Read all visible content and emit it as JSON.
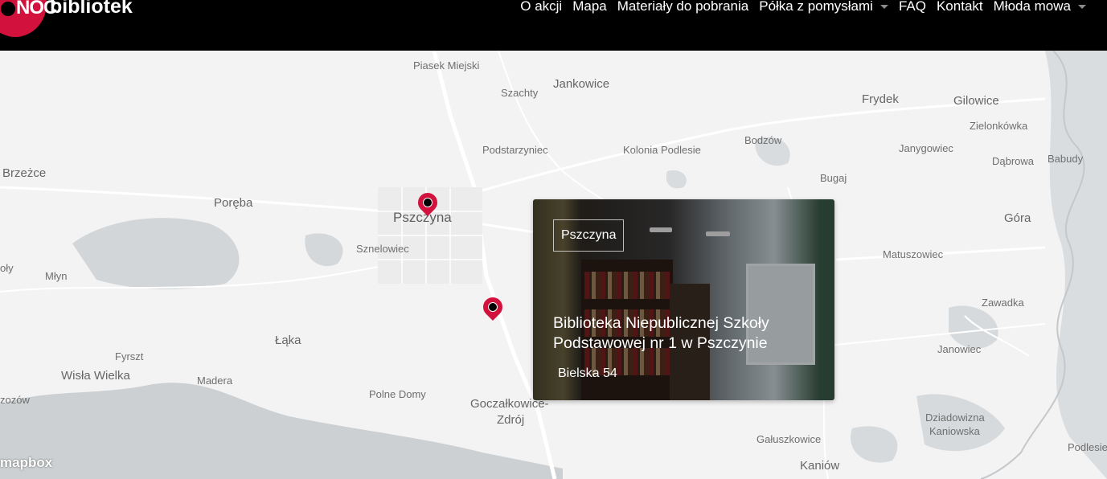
{
  "brand": {
    "logo_mark": "NOC",
    "logo_text": "bibliotek"
  },
  "nav": [
    {
      "label": "O akcji",
      "dropdown": false
    },
    {
      "label": "Mapa",
      "dropdown": false
    },
    {
      "label": "Materiały do pobrania",
      "dropdown": false
    },
    {
      "label": "Półka z pomysłami",
      "dropdown": true
    },
    {
      "label": "FAQ",
      "dropdown": false
    },
    {
      "label": "Kontakt",
      "dropdown": false
    },
    {
      "label": "Młoda mowa",
      "dropdown": true
    }
  ],
  "map": {
    "places": {
      "piasek_miejski": "Piasek Miejski",
      "jankowice": "Jankowice",
      "szachty": "Szachty",
      "frydek": "Frydek",
      "gilowice": "Gilowice",
      "zielonkowka": "Zielonkówka",
      "podstarzyniec": "Podstarzyniec",
      "kolonia_podlesie": "Kolonia Podlesie",
      "bodzow": "Bodzów",
      "janygowiec": "Janygowiec",
      "dabrowa": "Dąbrowa",
      "babudy": "Babudy",
      "brzezce": "Brzeżce",
      "bugaj": "Bugaj",
      "poreba": "Poręba",
      "pszczyna": "Pszczyna",
      "gora": "Góra",
      "sznelowiec": "Sznelowiec",
      "matuszowiec": "Matuszowiec",
      "oly": "oły",
      "mlyn": "Młyn",
      "zawadka": "Zawadka",
      "laka": "Łąka",
      "janowiec": "Janowiec",
      "fyrszt": "Fyrszt",
      "wisla_wielka": "Wisła Wielka",
      "madera": "Madera",
      "zozow": "zozów",
      "polne_domy": "Polne Domy",
      "goczalkowice": "Goczałkowice-",
      "zdroj": "Zdrój",
      "dziadowizna": "Dziadowizna",
      "kaniowska": "Kaniowska",
      "galuszkowice": "Gałuszkowice",
      "podlesie": "Podlesie",
      "kaniow": "Kaniów"
    },
    "attribution": "mapbox",
    "marker_icons": [
      "map-pin-icon",
      "map-pin-icon"
    ],
    "accent_color": "#d2123d"
  },
  "popup": {
    "city": "Pszczyna",
    "title": "Biblioteka Niepublicznej Szkoły Podstawowej nr 1 w Pszczynie",
    "address": "Bielska 54"
  }
}
